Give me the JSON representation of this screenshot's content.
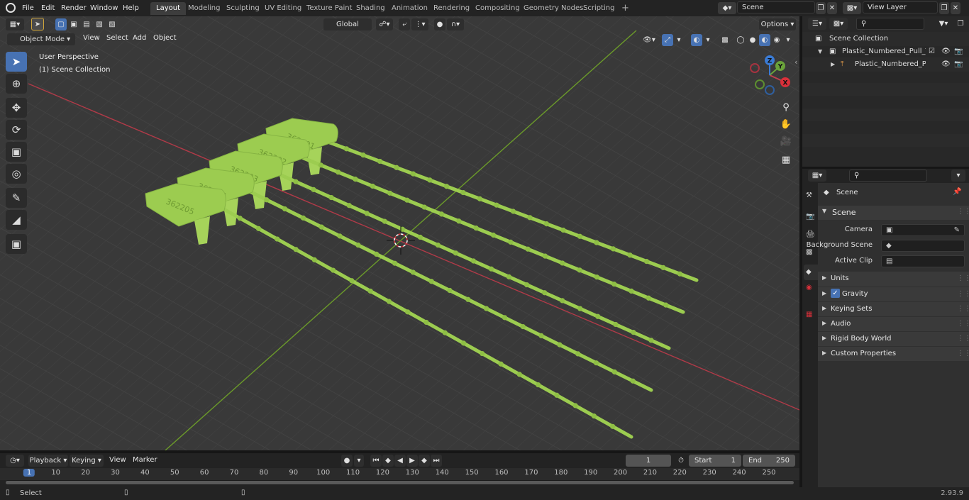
{
  "topbar": {
    "menus": [
      "File",
      "Edit",
      "Render",
      "Window",
      "Help"
    ],
    "workspaces": [
      "Layout",
      "Modeling",
      "Sculpting",
      "UV Editing",
      "Texture Paint",
      "Shading",
      "Animation",
      "Rendering",
      "Compositing",
      "Geometry Nodes",
      "Scripting"
    ],
    "active_workspace": "Layout",
    "add_tab": "+",
    "scene_name": "Scene",
    "view_layer": "View Layer"
  },
  "viewport": {
    "mode": "Object Mode",
    "menus": [
      "View",
      "Select",
      "Add",
      "Object"
    ],
    "transform_orientation": "Global",
    "options_label": "Options",
    "perspective_label": "User Perspective",
    "collection_label": "(1) Scene Collection",
    "tags": [
      "362201",
      "362202",
      "362203",
      "362204",
      "362205"
    ],
    "gizmo": {
      "x": "X",
      "y": "Y",
      "z": "Z"
    }
  },
  "outliner": {
    "root": "Scene Collection",
    "collection": "Plastic_Numbered_Pull_Tie_Se",
    "object": "Plastic_Numbered_Pull_T"
  },
  "properties": {
    "context": "Scene",
    "panel": "Scene",
    "fields": [
      {
        "label": "Camera",
        "value": ""
      },
      {
        "label": "Background Scene",
        "value": ""
      },
      {
        "label": "Active Clip",
        "value": ""
      }
    ],
    "subpanels": [
      "Units",
      "Gravity",
      "Keying Sets",
      "Audio",
      "Rigid Body World",
      "Custom Properties"
    ],
    "gravity_checked": true
  },
  "timeline": {
    "menus": [
      "Playback",
      "Keying",
      "View",
      "Marker"
    ],
    "current_frame": "1",
    "start_label": "Start",
    "start": "1",
    "end_label": "End",
    "end": "250",
    "ticks": [
      "1",
      "10",
      "20",
      "30",
      "40",
      "50",
      "60",
      "70",
      "80",
      "90",
      "100",
      "110",
      "120",
      "130",
      "140",
      "150",
      "160",
      "170",
      "180",
      "190",
      "200",
      "210",
      "220",
      "230",
      "240",
      "250"
    ]
  },
  "status": {
    "left": "Select",
    "version": "2.93.9"
  },
  "colors": {
    "accent": "#4772b3",
    "object_green": "#9ccc50",
    "x_axis": "#b03a48",
    "y_axis": "#6b9a2a"
  }
}
